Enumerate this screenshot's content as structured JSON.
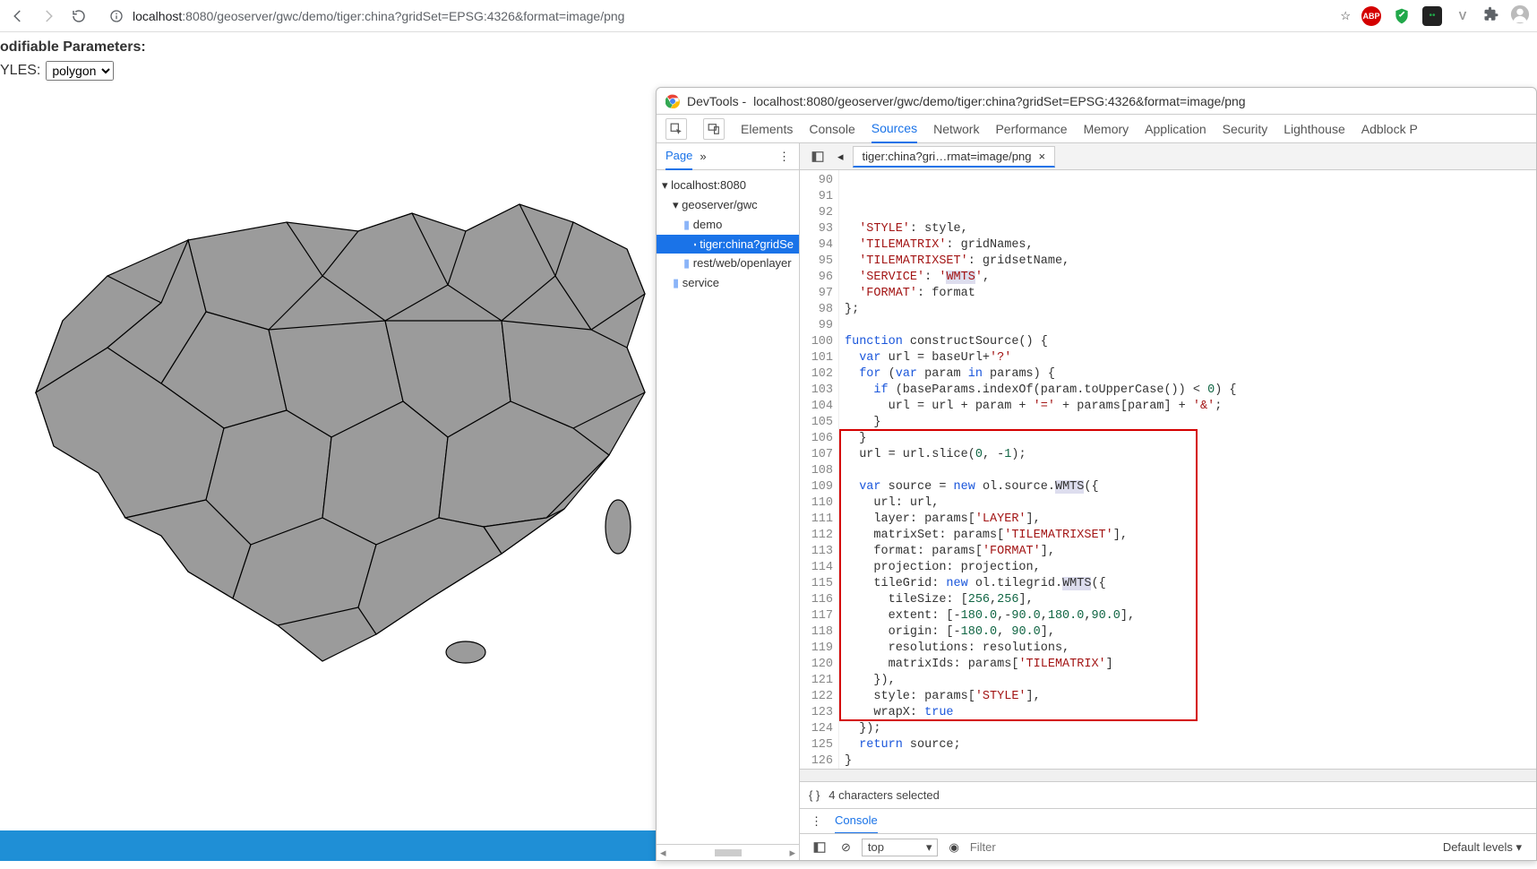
{
  "browser": {
    "url_host": "localhost",
    "url_port_path": ":8080/geoserver/gwc/demo/tiger:china?gridSet=EPSG:4326&format=image/png"
  },
  "page": {
    "params_header": "odifiable Parameters:",
    "styles_label": "YLES:",
    "styles_options": [
      "polygon"
    ],
    "styles_selected": "polygon"
  },
  "devtools": {
    "title_prefix": "DevTools - ",
    "title_url": "localhost:8080/geoserver/gwc/demo/tiger:china?gridSet=EPSG:4326&format=image/png",
    "tabs": [
      "Elements",
      "Console",
      "Sources",
      "Network",
      "Performance",
      "Memory",
      "Application",
      "Security",
      "Lighthouse",
      "Adblock P"
    ],
    "active_tab": "Sources",
    "left_tab": "Page",
    "tree": {
      "root": "localhost:8080",
      "n1": "geoserver/gwc",
      "n2": "demo",
      "file": "tiger:china?gridSe",
      "n3": "rest/web/openlayer",
      "n4": "service"
    },
    "source_tab_name": "tiger:china?gri…rmat=image/png",
    "status_text": "4 characters selected",
    "console_tab": "Console",
    "console_context": "top",
    "console_filter_placeholder": "Filter",
    "console_levels": "Default levels ▾",
    "code_start_line": 90,
    "code_lines": [
      "  'STYLE': style,",
      "  'TILEMATRIX': gridNames,",
      "  'TILEMATRIXSET': gridsetName,",
      "  'SERVICE': 'WMTS',",
      "  'FORMAT': format",
      "};",
      "",
      "function constructSource() {",
      "  var url = baseUrl+'?'",
      "  for (var param in params) {",
      "    if (baseParams.indexOf(param.toUpperCase()) < 0) {",
      "      url = url + param + '=' + params[param] + '&';",
      "    }",
      "  }",
      "  url = url.slice(0, -1);",
      "",
      "  var source = new ol.source.WMTS({",
      "    url: url,",
      "    layer: params['LAYER'],",
      "    matrixSet: params['TILEMATRIXSET'],",
      "    format: params['FORMAT'],",
      "    projection: projection,",
      "    tileGrid: new ol.tilegrid.WMTS({",
      "      tileSize: [256,256],",
      "      extent: [-180.0,-90.0,180.0,90.0],",
      "      origin: [-180.0, 90.0],",
      "      resolutions: resolutions,",
      "      matrixIds: params['TILEMATRIX']",
      "    }),",
      "    style: params['STYLE'],",
      "    wrapX: true",
      "  });",
      "  return source;",
      "}",
      "",
      "",
      ""
    ],
    "highlight_box": {
      "from_line": 106,
      "to_line": 123
    }
  }
}
